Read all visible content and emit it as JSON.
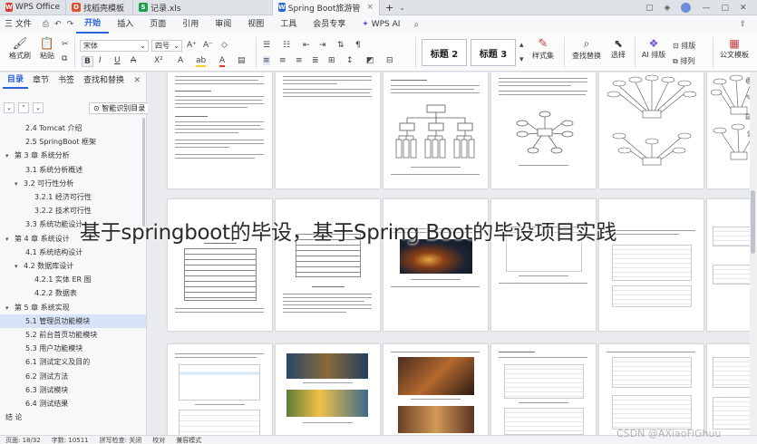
{
  "tabs": [
    {
      "label": "WPS Office",
      "color": "#d83b2e",
      "glyph": "W"
    },
    {
      "label": "找稻壳模板",
      "color": "#e0512f",
      "glyph": "D"
    },
    {
      "label": "记录.xls",
      "color": "#1a9e4f",
      "glyph": "S"
    },
    {
      "label": "Spring Boot旅游管理系统.d",
      "color": "#2b63d9",
      "glyph": "W"
    }
  ],
  "menu": {
    "file": "三 文件",
    "items": [
      "开始",
      "插入",
      "页面",
      "引用",
      "审阅",
      "视图",
      "工具",
      "会员专享"
    ],
    "wps_ai": "WPS AI",
    "search_icon": "search-icon"
  },
  "ribbon": {
    "format_painter": "格式刷",
    "paste": "粘贴",
    "font_name": "宋体",
    "font_size": "四号",
    "bold": "B",
    "italic": "I",
    "underline": "U",
    "styles": [
      "标题 2",
      "标题 3"
    ],
    "style_set": "样式集",
    "find_replace": "查找替换",
    "select": "选择",
    "ai_layout": "AI 排版",
    "layout": "排版",
    "sort": "排列",
    "public_template": "公文模板"
  },
  "sidebar": {
    "tabs": [
      "目录",
      "章节",
      "书签",
      "查找和替换"
    ],
    "smart_toc": "智能识别目录",
    "toc": [
      {
        "label": "2.4 Tomcat 介绍",
        "level": 2,
        "caret": ""
      },
      {
        "label": "2.5 SpringBoot 框架",
        "level": 2,
        "caret": ""
      },
      {
        "label": "第 3 章 系统分析",
        "level": 1,
        "caret": "▾"
      },
      {
        "label": "3.1 系统分析概述",
        "level": 2,
        "caret": ""
      },
      {
        "label": "3.2 可行性分析",
        "level": 2,
        "caret": "▾"
      },
      {
        "label": "3.2.1 经济可行性",
        "level": 3,
        "caret": ""
      },
      {
        "label": "3.2.2 技术可行性",
        "level": 3,
        "caret": ""
      },
      {
        "label": "3.3 系统功能设计",
        "level": 2,
        "caret": ""
      },
      {
        "label": "第 4 章 系统设计",
        "level": 1,
        "caret": "▾"
      },
      {
        "label": "4.1 系统结构设计",
        "level": 2,
        "caret": ""
      },
      {
        "label": "4.2 数据库设计",
        "level": 2,
        "caret": "▾"
      },
      {
        "label": "4.2.1 实体 ER 图",
        "level": 3,
        "caret": ""
      },
      {
        "label": "4.2.2 数据表",
        "level": 3,
        "caret": ""
      },
      {
        "label": "第 5 章 系统实现",
        "level": 1,
        "caret": "▾"
      },
      {
        "label": "5.1 管理员功能模块",
        "level": 2,
        "caret": ""
      },
      {
        "label": "5.2 前台首页功能模块",
        "level": 2,
        "caret": ""
      },
      {
        "label": "5.3 用户功能模块",
        "level": 2,
        "caret": ""
      },
      {
        "label": "6.1 测试定义及目的",
        "level": 2,
        "caret": ""
      },
      {
        "label": "6.2 测试方法",
        "level": 2,
        "caret": ""
      },
      {
        "label": "6.3 测试模块",
        "level": 2,
        "caret": ""
      },
      {
        "label": "6.4 测试结果",
        "level": 2,
        "caret": ""
      },
      {
        "label": "结  论",
        "level": 1,
        "caret": ""
      }
    ]
  },
  "headline": "基于springboot的毕设，基于Spring Boot的毕设项目实践",
  "status": {
    "page": "页面: 18/32",
    "words": "字数: 10511",
    "spell": "拼写检查: 关闭",
    "proof": "校对",
    "compat": "兼容模式"
  },
  "watermark": "CSDN @AXiaoFiGhuu"
}
